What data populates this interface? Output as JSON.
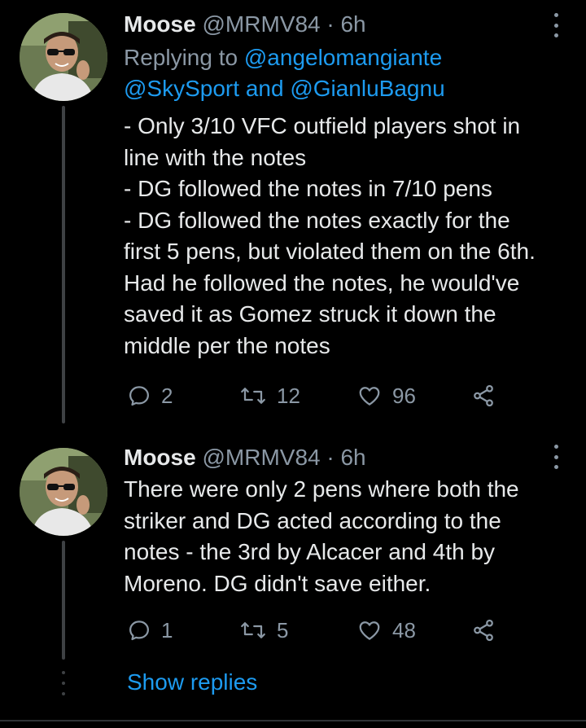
{
  "tweets": [
    {
      "name": "Moose",
      "handle": "@MRMV84",
      "separator": "·",
      "time": "6h",
      "replying_prefix": "Replying to",
      "replying_to_1": "@angelomangiante",
      "replying_to_2": "@SkySport",
      "replying_and": "and",
      "replying_to_3": "@GianluBagnu",
      "text_lines": [
        "- Only 3/10 VFC outfield players shot in",
        "line with the notes",
        "- DG followed the notes in 7/10 pens",
        "- DG followed the notes exactly for the",
        "first 5 pens, but violated them on the 6th.",
        "Had he followed the notes, he would've",
        "saved it as Gomez struck it down the",
        "middle per the notes"
      ],
      "reply_count": "2",
      "retweet_count": "12",
      "like_count": "96"
    },
    {
      "name": "Moose",
      "handle": "@MRMV84",
      "separator": "·",
      "time": "6h",
      "text_lines": [
        "There were only 2 pens where both the",
        "striker and DG acted according to the",
        "notes - the 3rd by Alcacer and 4th by",
        "Moreno. DG didn't save either."
      ],
      "reply_count": "1",
      "retweet_count": "5",
      "like_count": "48"
    }
  ],
  "show_replies": "Show replies",
  "icons": {
    "reply": "reply-icon",
    "retweet": "retweet-icon",
    "like": "heart-icon",
    "share": "share-icon",
    "more": "more-vertical-icon"
  },
  "colors": {
    "background": "#000000",
    "text": "#e7e9ea",
    "muted": "#8b98a5",
    "link": "#1d9bf0",
    "thread_line": "#3e4144"
  }
}
